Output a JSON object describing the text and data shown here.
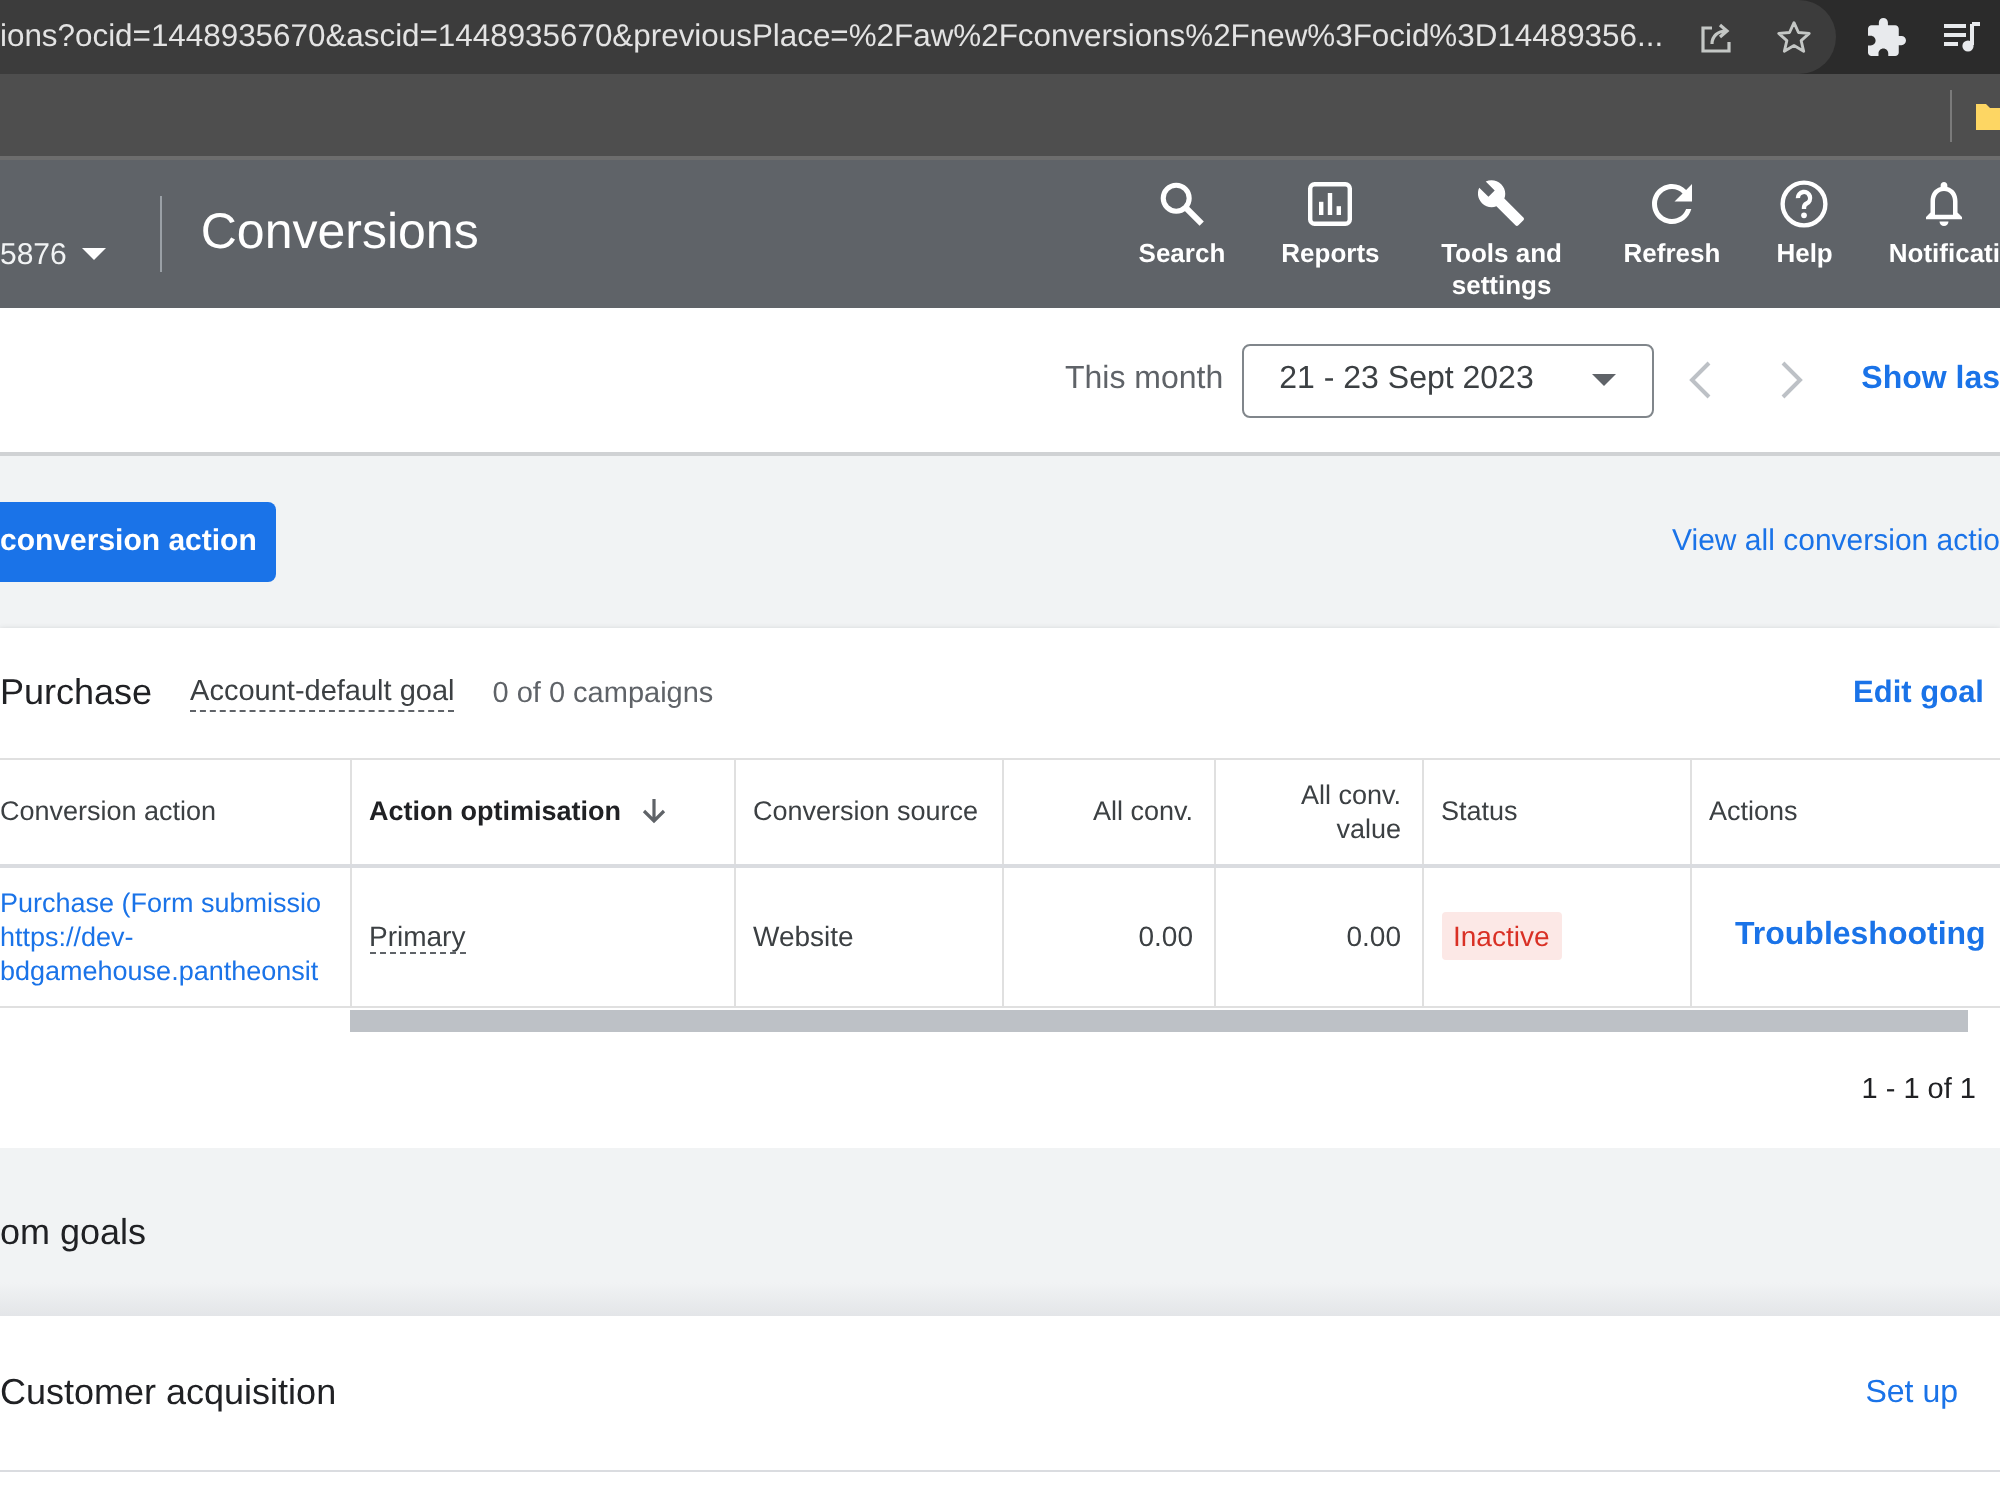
{
  "browser": {
    "url": "ions?ocid=1448935670&ascid=1448935670&previousPlace=%2Faw%2Fconversions%2Fnew%3Focid%3D14489356..."
  },
  "header": {
    "account": "5876",
    "title": "Conversions",
    "tools": [
      {
        "label": "Search"
      },
      {
        "label": "Reports"
      },
      {
        "label": "Tools and settings"
      },
      {
        "label": "Refresh"
      },
      {
        "label": "Help"
      },
      {
        "label": "Notificati"
      }
    ]
  },
  "date_bar": {
    "preset": "This month",
    "range": "21 - 23 Sept 2023",
    "link": "Show las"
  },
  "toolbar": {
    "button": "conversion action",
    "link": "View all conversion actio"
  },
  "goal": {
    "title": "Purchase",
    "goal_type": "Account-default goal",
    "campaigns": "0 of 0 campaigns",
    "edit_link": "Edit goal",
    "table": {
      "columns": [
        {
          "label": "Conversion action",
          "sorted": false
        },
        {
          "label": "Action optimisation",
          "sorted": true
        },
        {
          "label": "Conversion source",
          "sorted": false
        },
        {
          "label": "All conv.",
          "sorted": false
        },
        {
          "label": "All conv. value",
          "sorted": false
        },
        {
          "label": "Status",
          "sorted": false
        },
        {
          "label": "Actions",
          "sorted": false
        }
      ],
      "rows": [
        {
          "name": "Purchase (Form submissio https://dev-bdgamehouse.pantheonsit",
          "optimisation": "Primary",
          "source": "Website",
          "all_conv": "0.00",
          "all_conv_value": "0.00",
          "status": "Inactive",
          "action": "Troubleshooting"
        }
      ]
    },
    "pagination": "1 - 1 of 1"
  },
  "other_goals": {
    "title": "om goals",
    "items": [
      {
        "name": "Customer acquisition",
        "link": "Set up"
      }
    ]
  }
}
